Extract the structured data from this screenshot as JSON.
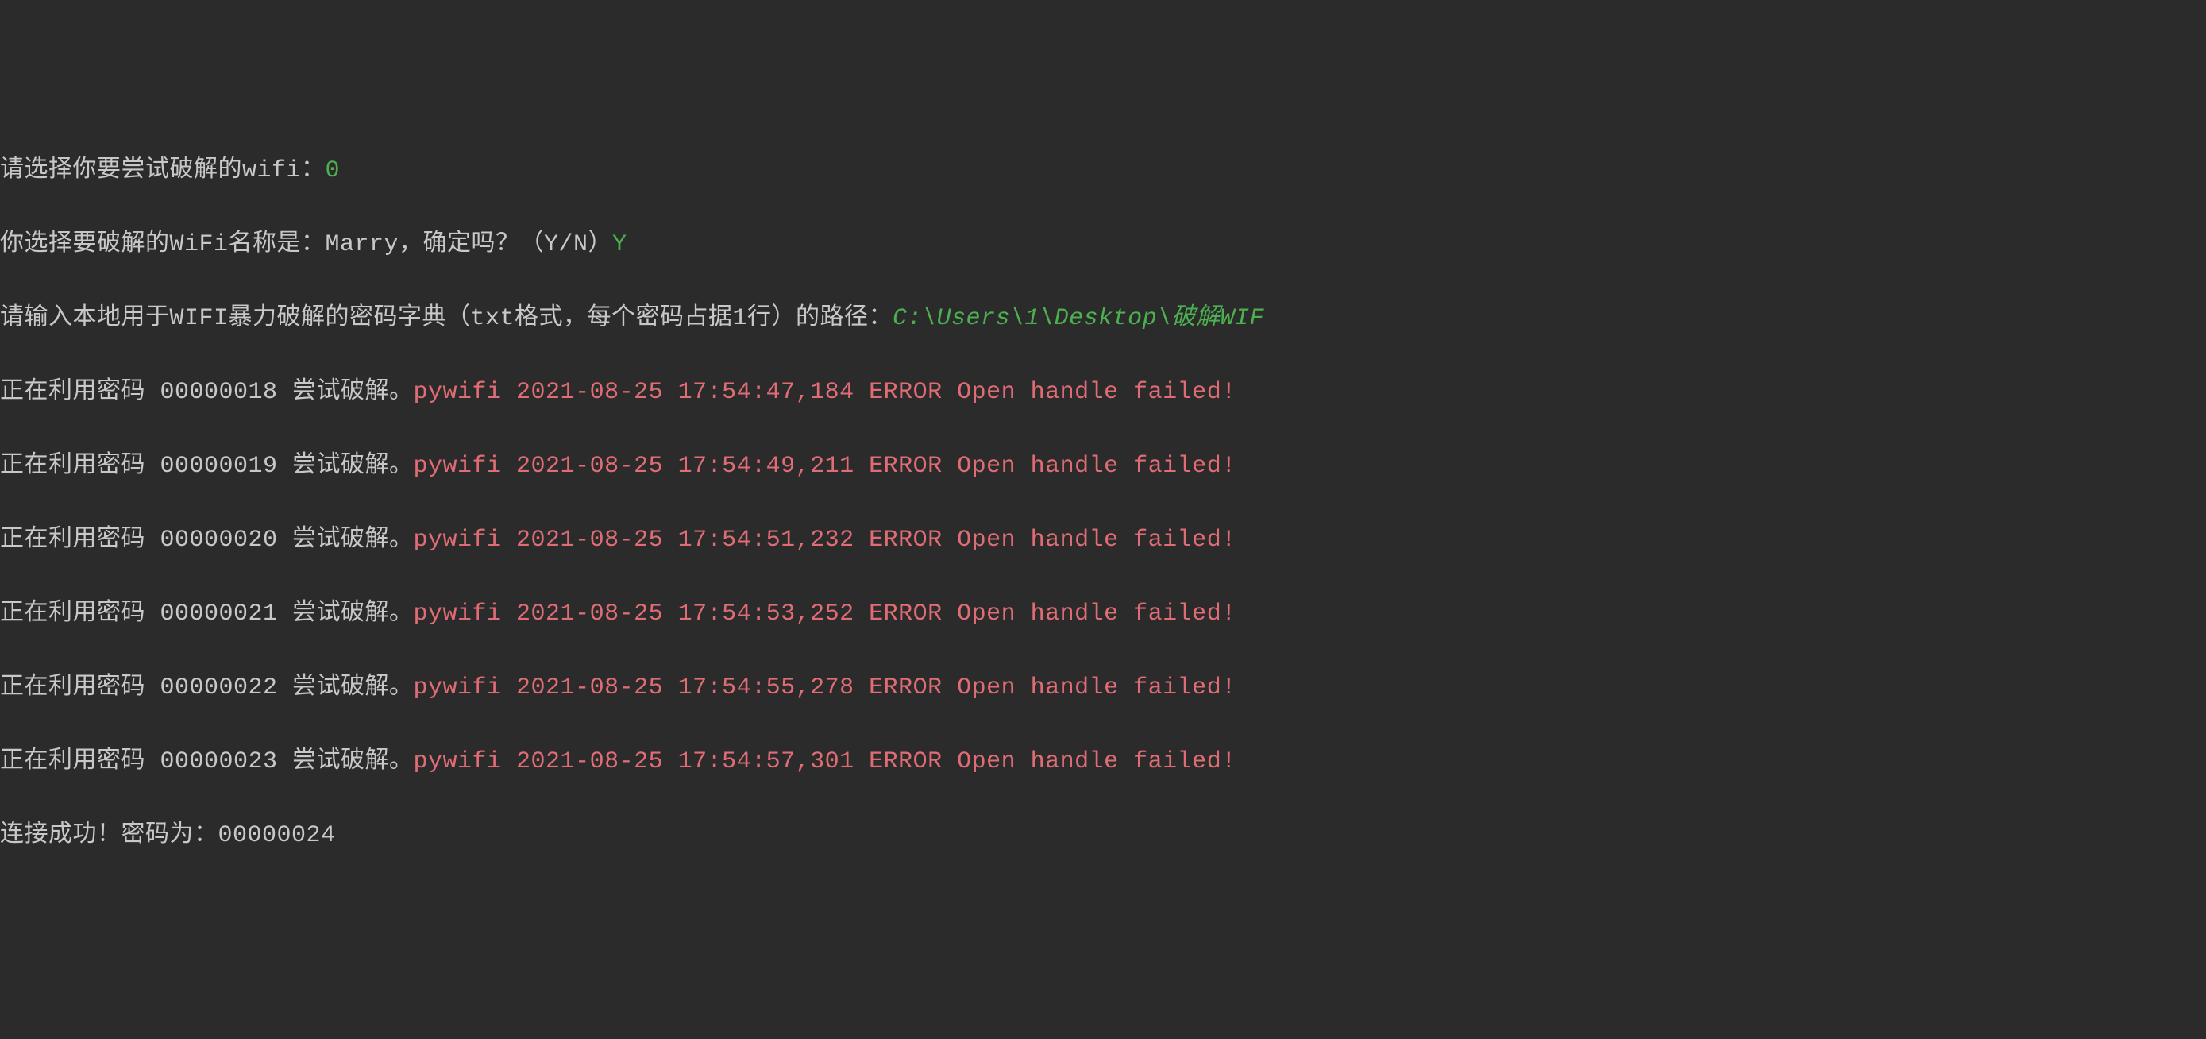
{
  "prompts": {
    "select_wifi": "请选择你要尝试破解的wifi：",
    "select_wifi_input": "0",
    "confirm_wifi_prefix": "你选择要破解的WiFi名称是：Marry，确定吗？（Y/N）",
    "confirm_wifi_input": "Y",
    "dict_path_prompt": "请输入本地用于WIFI暴力破解的密码字典（txt格式，每个密码占据1行）的路径：",
    "dict_path_input": "C:\\Users\\1\\Desktop\\破解WIF"
  },
  "attempts": [
    {
      "prefix": "正在利用密码 00000018 尝试破解。",
      "error": "pywifi 2021-08-25 17:54:47,184 ERROR Open handle failed!"
    },
    {
      "prefix": "正在利用密码 00000019 尝试破解。",
      "error": "pywifi 2021-08-25 17:54:49,211 ERROR Open handle failed!"
    },
    {
      "prefix": "正在利用密码 00000020 尝试破解。",
      "error": "pywifi 2021-08-25 17:54:51,232 ERROR Open handle failed!"
    },
    {
      "prefix": "正在利用密码 00000021 尝试破解。",
      "error": "pywifi 2021-08-25 17:54:53,252 ERROR Open handle failed!"
    },
    {
      "prefix": "正在利用密码 00000022 尝试破解。",
      "error": "pywifi 2021-08-25 17:54:55,278 ERROR Open handle failed!"
    },
    {
      "prefix": "正在利用密码 00000023 尝试破解。",
      "error": "pywifi 2021-08-25 17:54:57,301 ERROR Open handle failed!"
    }
  ],
  "success": "连接成功！密码为：00000024"
}
